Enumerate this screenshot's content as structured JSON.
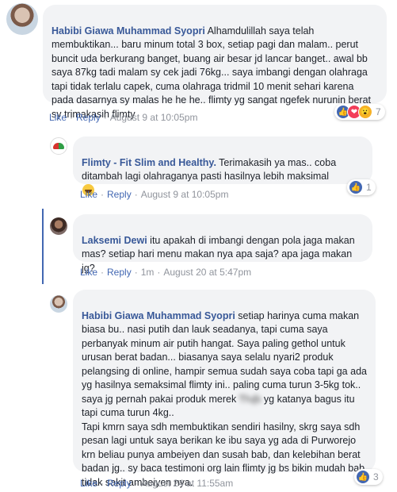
{
  "comments": [
    {
      "author": "Habibi Giawa Muhammad Syopri",
      "text": " Alhamdulillah saya telah membuktikan... baru minum total 3 box, setiap pagi dan malam.. perut buncit uda berkurang banget, buang air besar jd lancar banget.. awal bb saya 87kg tadi malam sy cek jadi 76kg... saya imbangi dengan olahraga tapi tidak terlalu capek, cuma olahraga tridmil 10 menit sehari karena pada dasarnya sy malas he he he.. flimty yg sangat ngefek nurunin berat sy trimakasih flimty",
      "like": "Like",
      "reply": "Reply",
      "time": "August 9 at 10:05pm",
      "reaction_count": "7"
    },
    {
      "author": "Flimty - Fit Slim and Healthy.",
      "text": " Terimakasih ya mas.. coba ditambah lagi olahraganya pasti hasilnya lebih maksimal",
      "like": "Like",
      "reply": "Reply",
      "time": "August 9 at 10:05pm",
      "reaction_count": "1"
    },
    {
      "author": "Laksemi Dewi",
      "text": " itu apakah di imbangi dengan pola jaga makan mas? setiap hari menu makan nya apa saja? apa jaga makan jg?",
      "like": "Like",
      "reply": "Reply",
      "duration": "1m",
      "time": "August 20 at 5:47pm"
    },
    {
      "author": "Habibi Giawa Muhammad Syopri",
      "text_a": " setiap harinya cuma makan biasa bu.. nasi putih dan lauk seadanya, tapi cuma saya perbanyak minum air putih hangat. Saya paling gethol untuk urusan berat badan... biasanya saya selalu nyari2 produk pelangsing di online, hampir semua sudah saya coba tapi ga ada yg hasilnya semaksimal flimty ini.. paling cuma turun 3-5kg tok.. saya jg pernah pakai produk merek ",
      "redacted": "Ƭƕʃs",
      "text_b": " yg katanya bagus itu tapi cuma turun 4kg..\nTapi kmrn saya sdh membuktikan sendiri hasilny, skrg saya sdh pesan lagi untuk saya berikan ke ibu saya yg ada di Purworejo krn beliau punya ambeiyen dan susah bab, dan kelebihan berat badan jg.. sy baca testimoni org lain flimty jg bs bikin mudah bab tidak sakit ambeiyen nya.",
      "like": "Like",
      "reply": "Reply",
      "time": "August 24 at 11:55am",
      "reaction_count": "3"
    }
  ],
  "colors": {
    "link": "#4267b2",
    "author": "#385898",
    "bubble": "#f2f3f5",
    "meta": "#90949c"
  }
}
